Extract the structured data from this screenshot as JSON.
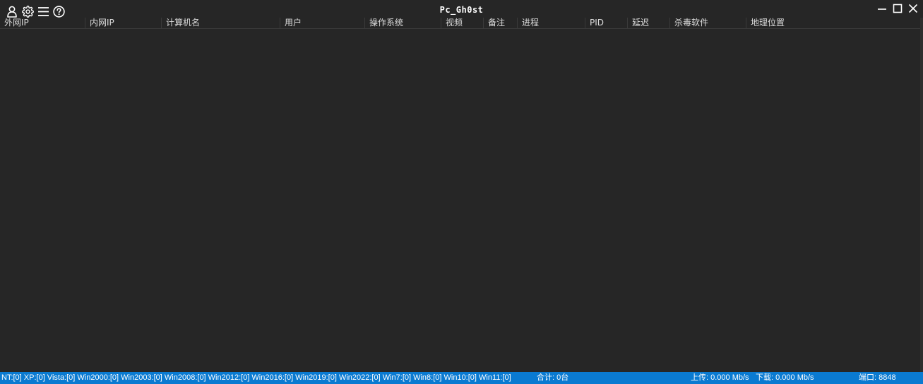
{
  "window": {
    "title": "Pc_Gh0st"
  },
  "toolbar_icons": [
    "user-icon",
    "gear-icon",
    "menu-icon",
    "help-icon"
  ],
  "window_controls": [
    "minimize-icon",
    "maximize-icon",
    "close-icon"
  ],
  "columns": [
    "外网IP",
    "内网IP",
    "计算机名",
    "用户",
    "操作系统",
    "视频",
    "备注",
    "进程",
    "PID",
    "延迟",
    "杀毒软件",
    "地理位置"
  ],
  "rows": [],
  "statusbar": {
    "os_counts": "NT:[0] XP:[0] Vista:[0] Win2000:[0] Win2003:[0] Win2008:[0] Win2012:[0] Win2016:[0] Win2019:[0] Win2022:[0] Win7:[0] Win8:[0] Win10:[0] Win11:[0]",
    "total": "合计: 0台",
    "upload": "上传: 0.000 Mb/s",
    "download": "下载: 0.000 Mb/s",
    "port": "端口: 8848"
  },
  "colors": {
    "background": "#262626",
    "statusbar": "#0a7ad1",
    "text": "#dcdcdc",
    "title": "#ffffff"
  }
}
